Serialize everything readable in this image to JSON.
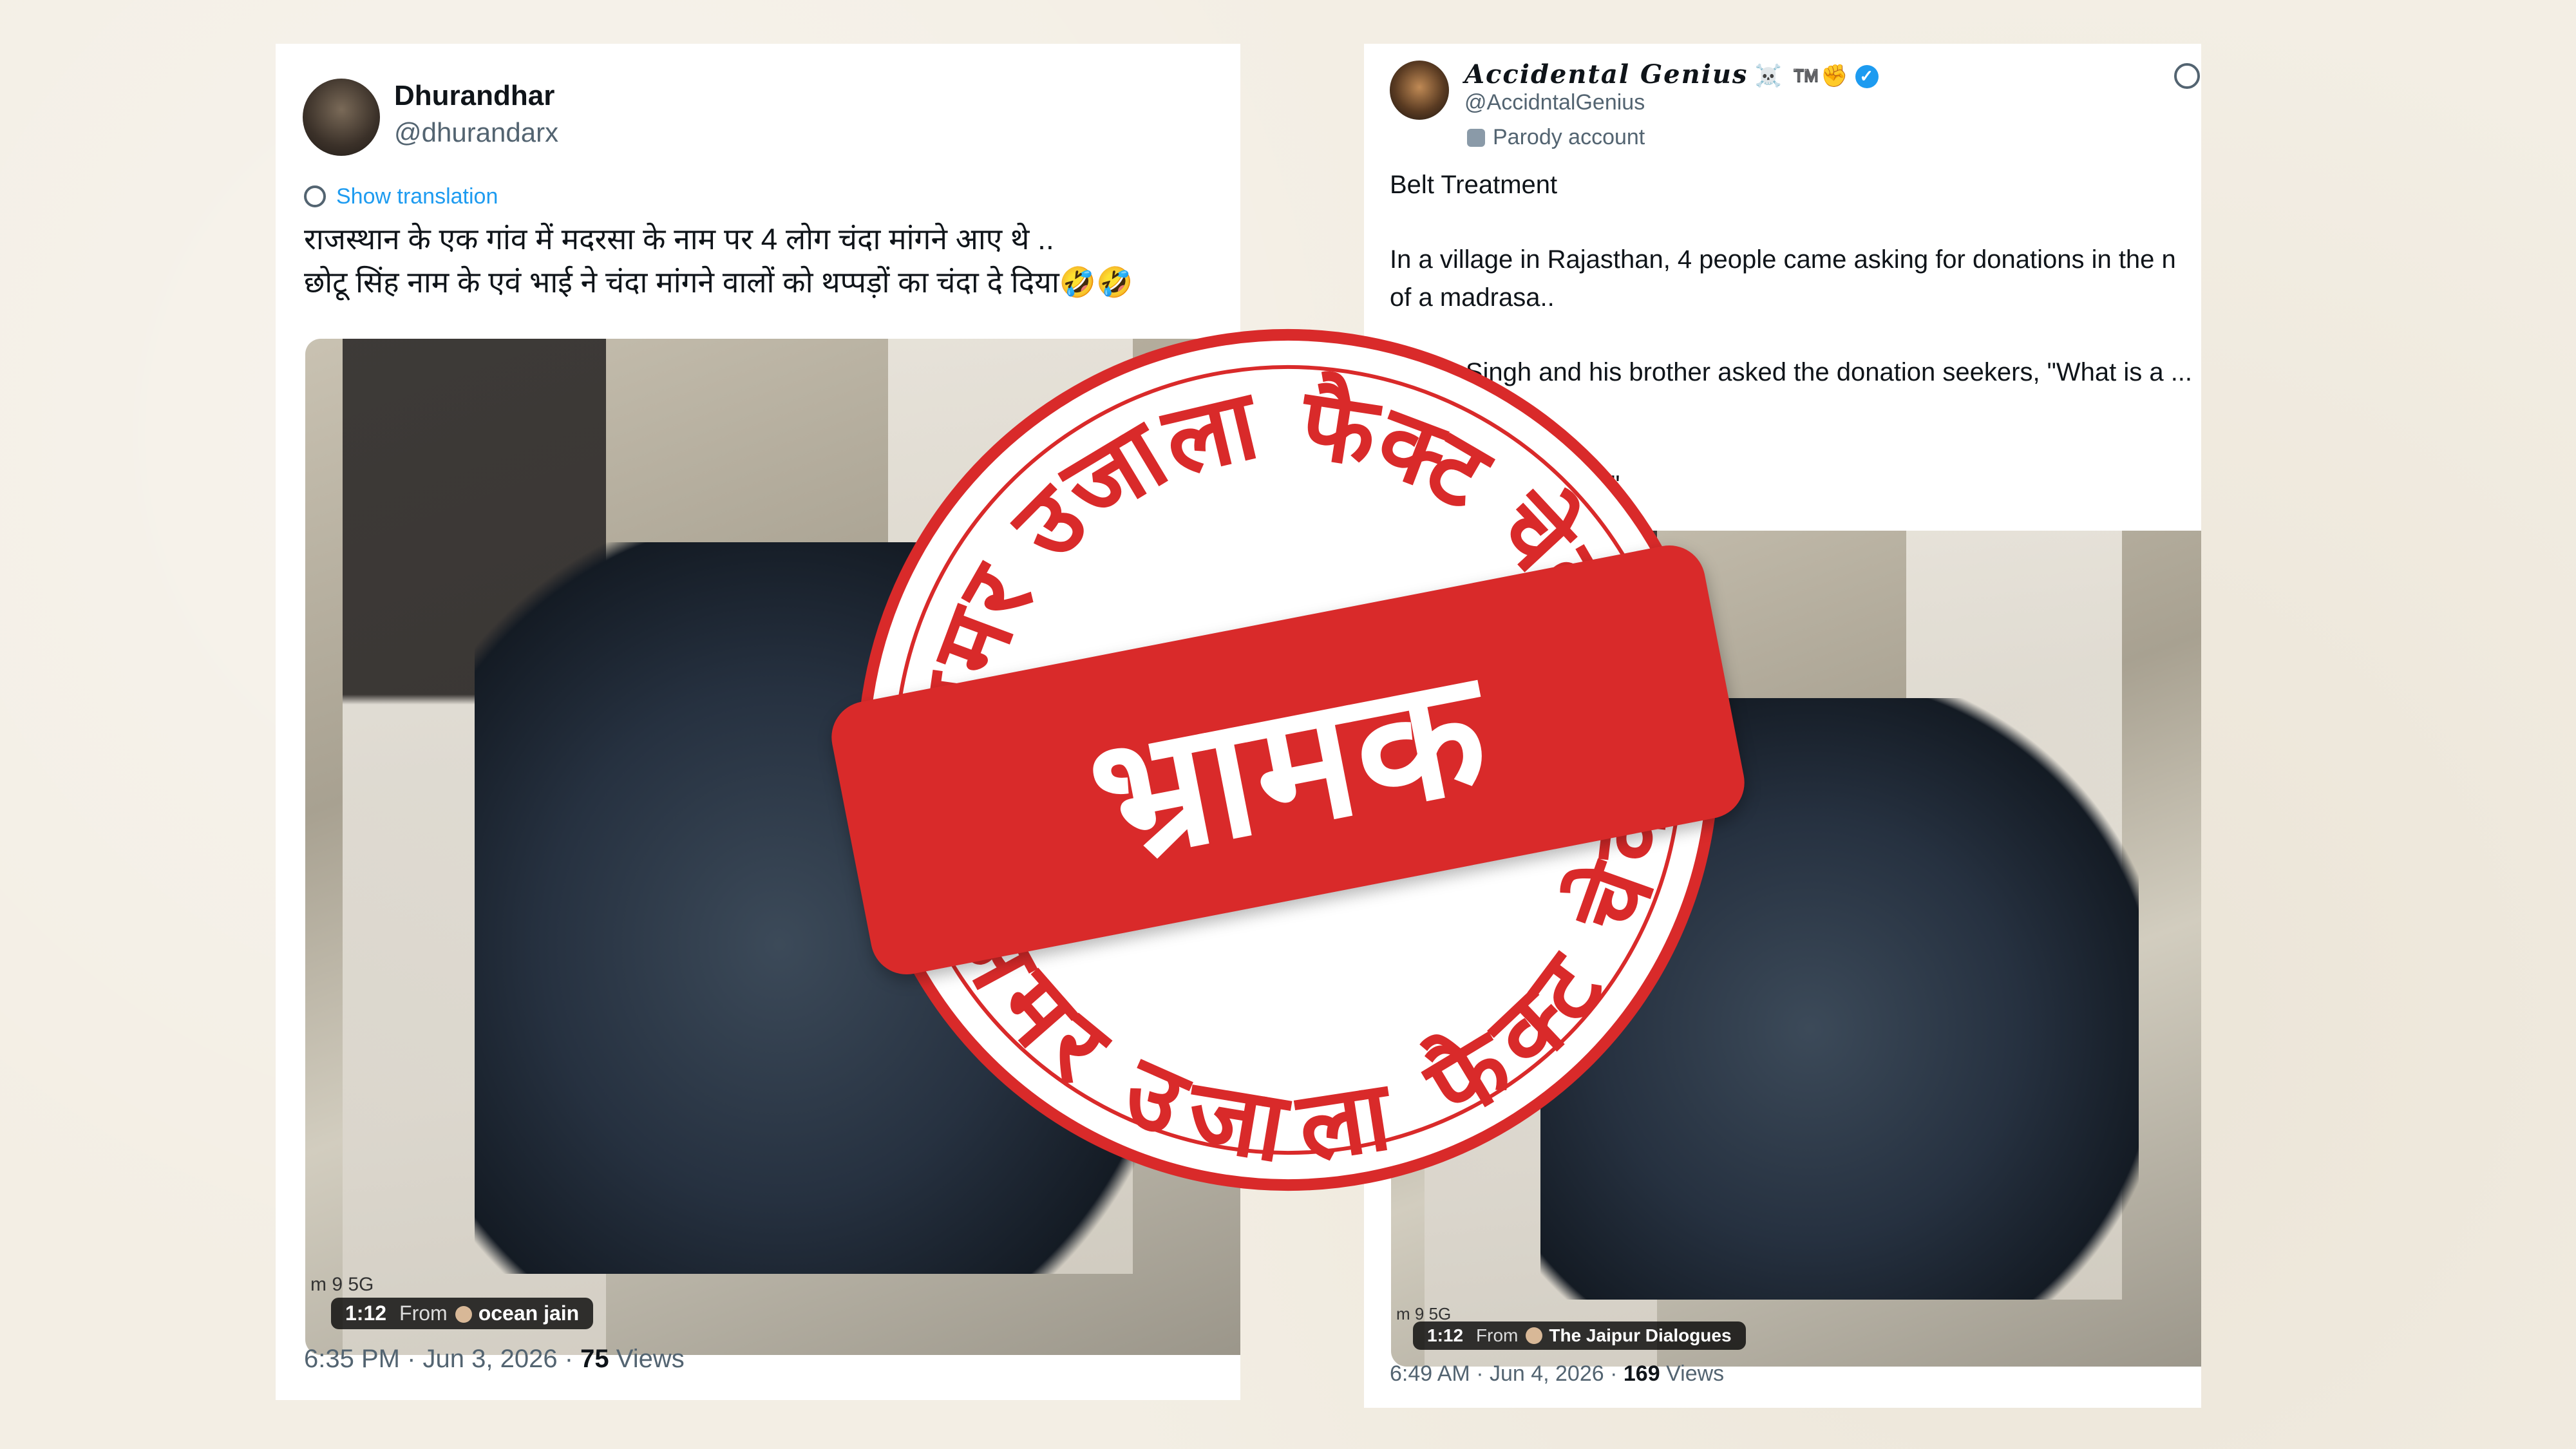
{
  "tweet_left": {
    "name": "Dhurandhar",
    "handle": "@dhurandarx",
    "translate_label": "Show translation",
    "lines": [
      "राजस्थान के एक गांव में मदरसा के नाम पर 4 लोग चंदा मांगने आए थे ..",
      "छोटू सिंह नाम के एवं भाई ने चंदा मांगने वालों को थप्पड़ों का चंदा दे दिया🤣🤣"
    ],
    "media": {
      "carrier": "m 9 5G",
      "duration": "1:12",
      "from_label": "From",
      "source": "ocean jain"
    },
    "time": "6:35 PM · Jun 3, 2026 · ",
    "views_count": "75",
    "views_label": " Views"
  },
  "tweet_right": {
    "name": "Accidental Genius",
    "name_extra": "☠️ ™️✊",
    "verified_icon": "✓",
    "handle": "@AccidntalGenius",
    "parody_label": "Parody account",
    "paragraphs": [
      "Belt Treatment",
      "In a village in Rajasthan, 4 people came asking for donations in the n of a madrasa..",
      "Chotu Singh and his brother asked the donation seekers, \"What is a ... to you?\"",
      "... lks replied, \"Kafir\""
    ],
    "media": {
      "carrier": "m 9 5G",
      "duration": "1:12",
      "from_label": "From",
      "source": "The Jaipur Dialogues"
    },
    "time": "6:49 AM · Jun 4, 2026 · ",
    "views_count": "169",
    "views_label": " Views"
  },
  "stamp": {
    "arc_top": "अमर उजाला फैक्ट चेक",
    "arc_bottom": "अमर उजाला फैक्ट चेक",
    "verdict": "भ्रामक",
    "color": "#d92a2a"
  }
}
